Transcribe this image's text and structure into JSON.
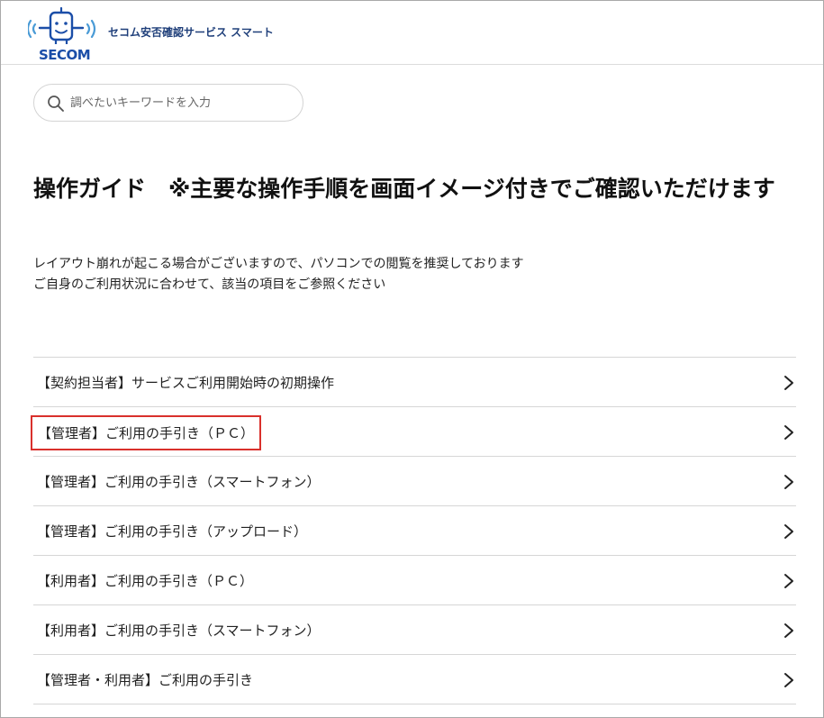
{
  "header": {
    "logo_text": "SECOM",
    "service_name": "セコム安否確認サービス スマート"
  },
  "search": {
    "placeholder": "調べたいキーワードを入力"
  },
  "main": {
    "title": "操作ガイド　※主要な操作手順を画面イメージ付きでご確認いただけます",
    "description_lines": [
      "レイアウト崩れが起こる場合がございますので、パソコンでの閲覧を推奨しております",
      "ご自身のご利用状況に合わせて、該当の項目をご参照ください"
    ],
    "items": [
      {
        "label": "【契約担当者】サービスご利用開始時の初期操作"
      },
      {
        "label": "【管理者】ご利用の手引き（ＰＣ）"
      },
      {
        "label": "【管理者】ご利用の手引き（スマートフォン）"
      },
      {
        "label": "【管理者】ご利用の手引き（アップロード）"
      },
      {
        "label": "【利用者】ご利用の手引き（ＰＣ）"
      },
      {
        "label": "【利用者】ご利用の手引き（スマートフォン）"
      },
      {
        "label": "【管理者・利用者】ご利用の手引き"
      }
    ]
  },
  "colors": {
    "brand": "#1b4ea8",
    "highlight": "#d9302c"
  },
  "icons": {
    "logo": "secom-mascot-logo",
    "search": "search-icon",
    "chevron": "chevron-right-icon"
  }
}
